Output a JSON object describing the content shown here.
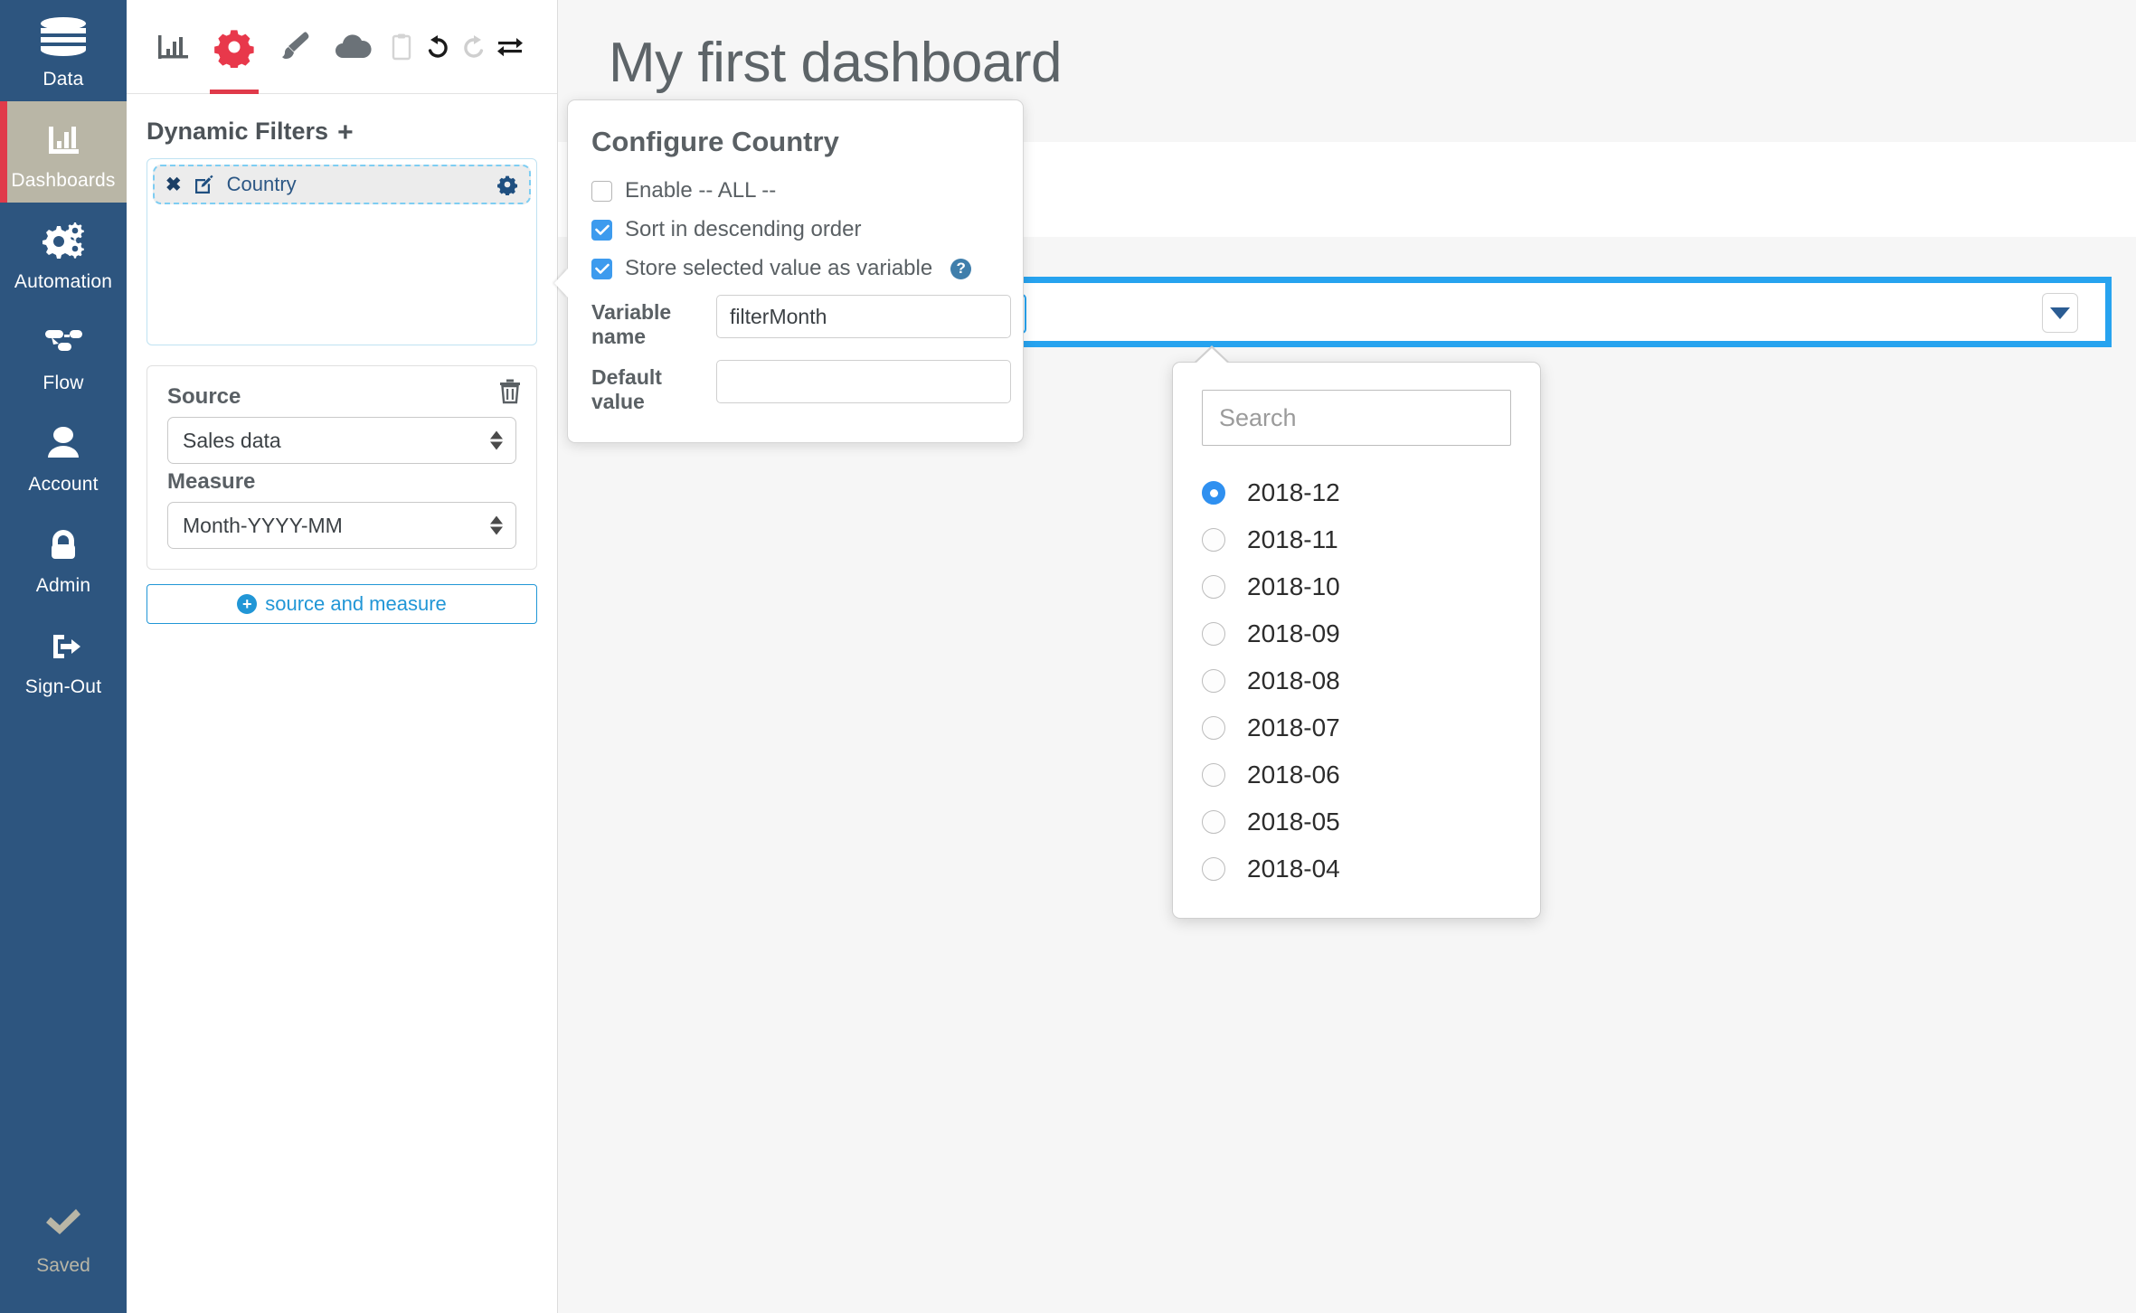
{
  "nav": {
    "items": [
      {
        "label": "Data",
        "icon": "database-icon",
        "active": false
      },
      {
        "label": "Dashboards",
        "icon": "bar-chart-icon",
        "active": true
      },
      {
        "label": "Automation",
        "icon": "gears-icon",
        "active": false
      },
      {
        "label": "Flow",
        "icon": "flow-icon",
        "active": false
      },
      {
        "label": "Account",
        "icon": "user-icon",
        "active": false
      },
      {
        "label": "Admin",
        "icon": "lock-icon",
        "active": false
      },
      {
        "label": "Sign-Out",
        "icon": "sign-out-icon",
        "active": false
      }
    ],
    "status": {
      "label": "Saved",
      "icon": "check-icon"
    },
    "bg_color": "#2d557f",
    "active_bg_color": "#b9b6a6",
    "active_accent_color": "#e03a4a"
  },
  "toolbar": {
    "tools": [
      {
        "name": "chart-icon",
        "title": "Chart"
      },
      {
        "name": "gear-icon",
        "title": "Settings",
        "active": true
      },
      {
        "name": "paintbrush-icon",
        "title": "Style"
      },
      {
        "name": "cloud-icon",
        "title": "Cloud"
      },
      {
        "name": "clipboard-icon",
        "title": "Clipboard"
      },
      {
        "name": "undo-icon",
        "title": "Undo"
      },
      {
        "name": "redo-icon",
        "title": "Redo"
      },
      {
        "name": "swap-icon",
        "title": "Swap"
      }
    ],
    "active_underline_color": "#e03a4a"
  },
  "panel": {
    "filters_heading": "Dynamic Filters",
    "add_filter_symbol": "+",
    "filter_chip": {
      "close_symbol": "✖",
      "label": "Country"
    },
    "source_card": {
      "source_label": "Source",
      "source_value": "Sales data",
      "measure_label": "Measure",
      "measure_value": "Month-YYYY-MM"
    },
    "add_button": {
      "plus": "+",
      "label": "source and measure"
    }
  },
  "popover": {
    "title": "Configure Country",
    "checkboxes": [
      {
        "label": "Enable -- ALL --",
        "checked": false,
        "help": false
      },
      {
        "label": "Sort in descending order",
        "checked": true,
        "help": false
      },
      {
        "label": "Store selected value as variable",
        "checked": true,
        "help": true
      }
    ],
    "help_symbol": "?",
    "variable_name_label": "Variable name",
    "variable_name_value": "filterMonth",
    "default_value_label": "Default value",
    "default_value_value": "",
    "default_value_placeholder": ""
  },
  "main": {
    "dashboard_title": "My first dashboard",
    "filter_bar": {
      "border_color": "#27a3ef",
      "country_button": {
        "name": "Country",
        "value": "2018-12",
        "chevron": "chevron-down-icon"
      },
      "caret_button_icon": "caret-down-icon"
    }
  },
  "dropdown": {
    "search_placeholder": "Search",
    "search_value": "",
    "selected": "2018-12",
    "options": [
      {
        "label": "2018-12",
        "selected": true
      },
      {
        "label": "2018-11",
        "selected": false
      },
      {
        "label": "2018-10",
        "selected": false
      },
      {
        "label": "2018-09",
        "selected": false
      },
      {
        "label": "2018-08",
        "selected": false
      },
      {
        "label": "2018-07",
        "selected": false
      },
      {
        "label": "2018-06",
        "selected": false
      },
      {
        "label": "2018-05",
        "selected": false
      },
      {
        "label": "2018-04",
        "selected": false
      }
    ],
    "selected_radio_color": "#2f90f0"
  }
}
